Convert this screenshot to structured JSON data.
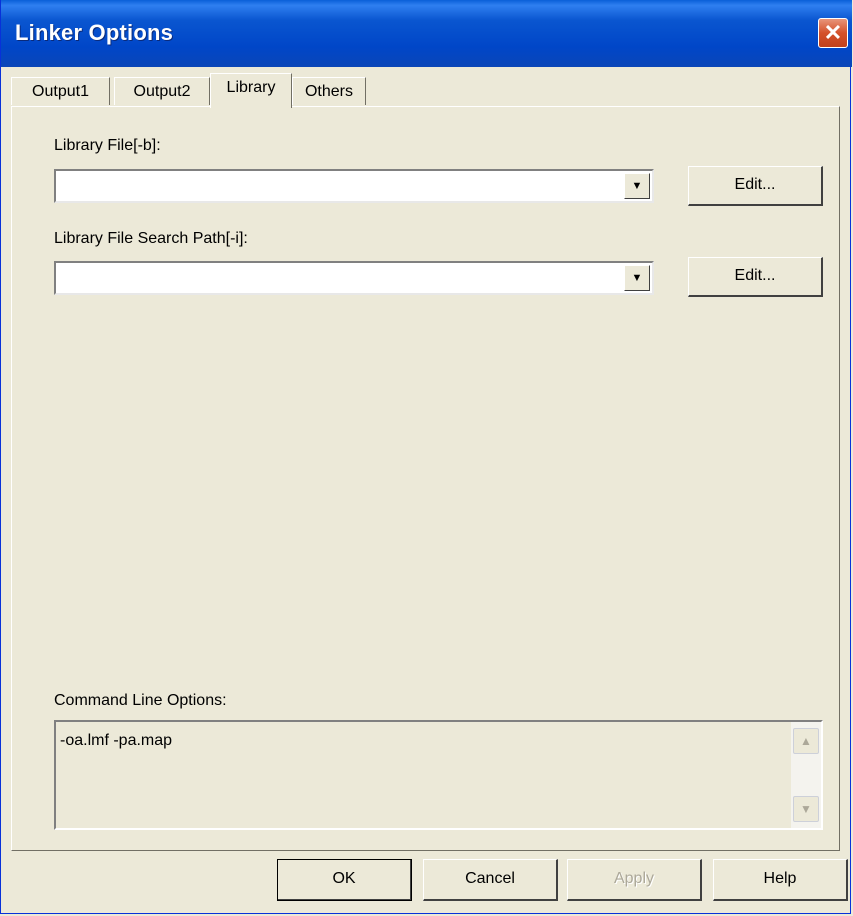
{
  "window": {
    "title": "Linker Options"
  },
  "tabs": [
    {
      "label": "Output1",
      "active": false
    },
    {
      "label": "Output2",
      "active": false
    },
    {
      "label": "Library",
      "active": true
    },
    {
      "label": "Others",
      "active": false
    }
  ],
  "library_file": {
    "label": "Library File[-b]:",
    "value": "",
    "edit_label": "Edit..."
  },
  "search_path": {
    "label": "Library File Search Path[-i]:",
    "value": "",
    "edit_label": "Edit..."
  },
  "command_line": {
    "label": "Command Line Options:",
    "text": "-oa.lmf -pa.map"
  },
  "buttons": {
    "ok": "OK",
    "cancel": "Cancel",
    "apply": "Apply",
    "help": "Help"
  },
  "icons": {
    "close": "close-icon",
    "dropdown": "chevron-down-icon",
    "scroll_up": "scroll-up-icon",
    "scroll_down": "scroll-down-icon"
  }
}
